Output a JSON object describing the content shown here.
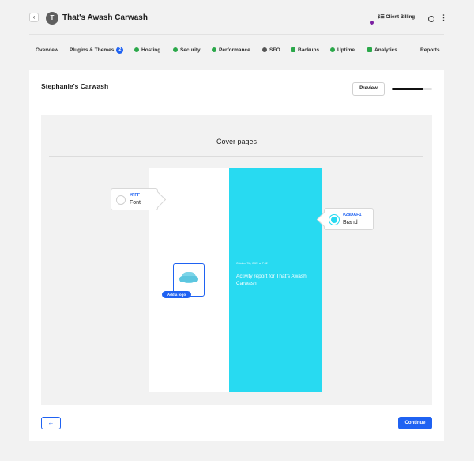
{
  "header": {
    "back_icon": "‹",
    "avatar_letter": "T",
    "site_title": "That's Awash Carwash",
    "billing_label": "$☰ Client Billing",
    "more_icon": "⋮"
  },
  "tabs": [
    {
      "label": "Overview"
    },
    {
      "label": "Plugins & Themes",
      "badge": "2"
    },
    {
      "label": "Hosting"
    },
    {
      "label": "Security"
    },
    {
      "label": "Performance"
    },
    {
      "label": "SEO"
    },
    {
      "label": "Backups"
    },
    {
      "label": "Uptime"
    },
    {
      "label": "Analytics"
    },
    {
      "label": "Reports"
    }
  ],
  "card": {
    "title": "Stephanie's Carwash",
    "preview_label": "Preview",
    "progress": 0.78
  },
  "stage": {
    "title": "Cover pages",
    "font_swatch": {
      "hex": "#FFF",
      "label": "Font"
    },
    "brand_swatch": {
      "hex": "#28DAF1",
      "label": "Brand"
    },
    "add_logo_label": "Add a logo",
    "cover_date": "October 7th, 2021 at 7:32",
    "cover_report": "Activity report for That's Awash Carwash"
  },
  "footer": {
    "prev_label": "←",
    "continue_label": "Continue"
  },
  "colors": {
    "accent": "#1f62f2",
    "brand": "#28daf1"
  }
}
